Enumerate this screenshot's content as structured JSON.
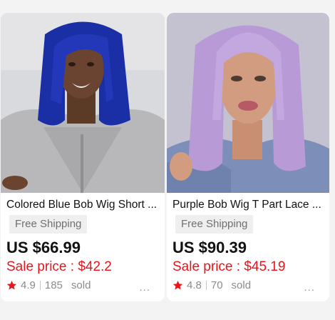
{
  "products": [
    {
      "title": "Colored Blue Bob Wig Short ...",
      "shipping": "Free Shipping",
      "price": "US $66.99",
      "sale_price": "Sale price : $42.2",
      "rating": "4.9",
      "reviews": "185",
      "sold": "sold",
      "more": "...",
      "hair_color": "#1a2fa6",
      "image": "Woman with short blue bob wig"
    },
    {
      "title": "Purple Bob Wig T Part Lace ...",
      "shipping": "Free Shipping",
      "price": "US $90.39",
      "sale_price": "Sale price : $45.19",
      "rating": "4.8",
      "reviews": "70",
      "sold": "sold",
      "more": "...",
      "hair_color": "#b79ad6",
      "image": "Woman with lavender purple bob wig"
    }
  ],
  "colors": {
    "sale": "#e8161c",
    "star": "#e8161c",
    "badge_bg": "#efefef"
  }
}
